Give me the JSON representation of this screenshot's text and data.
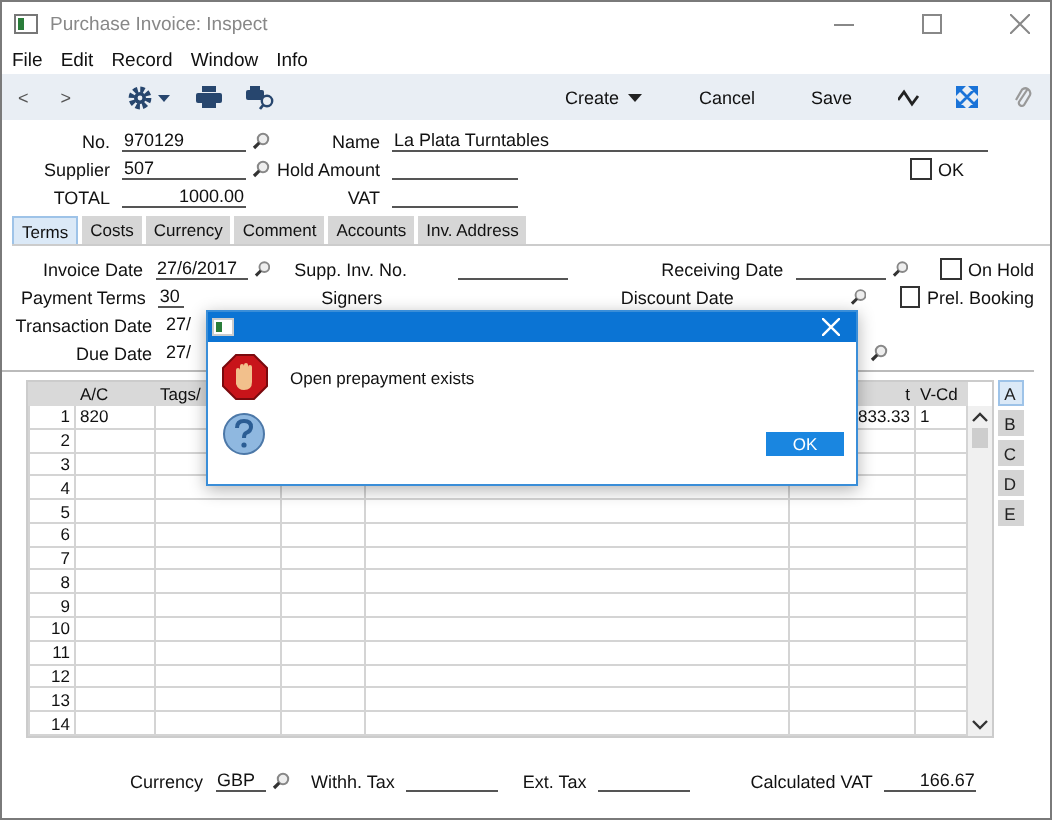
{
  "window": {
    "title": "Purchase Invoice: Inspect"
  },
  "menu": [
    "File",
    "Edit",
    "Record",
    "Window",
    "Info"
  ],
  "toolbar": {
    "back": "<",
    "forward": ">",
    "create": "Create",
    "cancel": "Cancel",
    "save": "Save"
  },
  "header": {
    "no": {
      "label": "No.",
      "value": "970129"
    },
    "supplier": {
      "label": "Supplier",
      "value": "507"
    },
    "total": {
      "label": "TOTAL",
      "value": "1000.00"
    },
    "name": {
      "label": "Name",
      "value": "La Plata Turntables"
    },
    "hold_amount": {
      "label": "Hold Amount"
    },
    "vat": {
      "label": "VAT"
    },
    "ok": {
      "label": "OK",
      "checked": false
    }
  },
  "tabs": [
    {
      "label": "Terms",
      "selected": true
    },
    {
      "label": "Costs",
      "selected": false
    },
    {
      "label": "Currency",
      "selected": false
    },
    {
      "label": "Comment",
      "selected": false
    },
    {
      "label": "Accounts",
      "selected": false
    },
    {
      "label": "Inv. Address",
      "selected": false
    }
  ],
  "terms": {
    "invoice_date": {
      "label": "Invoice Date",
      "value": "27/6/2017"
    },
    "supp_inv_no": {
      "label": "Supp. Inv. No."
    },
    "receiving_date": {
      "label": "Receiving Date"
    },
    "payment_terms": {
      "label": "Payment Terms",
      "value": "30"
    },
    "signers": {
      "label": "Signers"
    },
    "discount_date": {
      "label": "Discount Date"
    },
    "transaction_date": {
      "label": "Transaction Date",
      "value": "27/"
    },
    "due_date": {
      "label": "Due Date",
      "value": "27/"
    },
    "on_hold": {
      "label": "On Hold",
      "checked": false
    },
    "prel_booking": {
      "label": "Prel. Booking",
      "checked": false
    }
  },
  "grid": {
    "columns": {
      "ac": "A/C",
      "column_2": "Tags/",
      "column_5": "t",
      "v_cd": "V-Cd"
    },
    "rows": [
      {
        "number": "1",
        "ac": "820",
        "column_5": "833.33",
        "v_cd": "1"
      },
      {
        "number": "2"
      },
      {
        "number": "3"
      },
      {
        "number": "4"
      },
      {
        "number": "5"
      },
      {
        "number": "6"
      },
      {
        "number": "7"
      },
      {
        "number": "8"
      },
      {
        "number": "9"
      },
      {
        "number": "10"
      },
      {
        "number": "11"
      },
      {
        "number": "12"
      },
      {
        "number": "13"
      },
      {
        "number": "14"
      }
    ]
  },
  "side_tabs": [
    {
      "label": "A",
      "selected": true
    },
    {
      "label": "B",
      "selected": false
    },
    {
      "label": "C",
      "selected": false
    },
    {
      "label": "D",
      "selected": false
    },
    {
      "label": "E",
      "selected": false
    }
  ],
  "footer": {
    "currency": {
      "label": "Currency",
      "value": "GBP"
    },
    "withh_tax": {
      "label": "Withh. Tax"
    },
    "ext_tax": {
      "label": "Ext. Tax"
    },
    "calculated_vat": {
      "label": "Calculated VAT",
      "value": "166.67"
    }
  },
  "dialog": {
    "message": "Open prepayment exists",
    "button": "OK"
  }
}
